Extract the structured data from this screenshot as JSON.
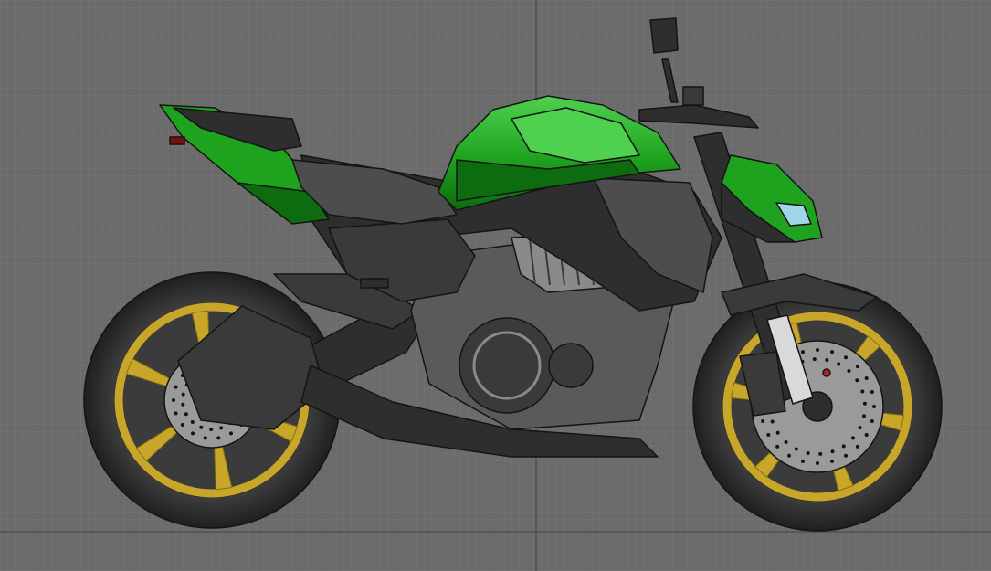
{
  "viewport": {
    "background_color": "#6b6b6b",
    "grid_minor_color": "#767676",
    "grid_major_color": "#4a4a4a"
  },
  "model": {
    "subject": "motorcycle-side-view",
    "colors": {
      "body_green": "#1fa31f",
      "body_green_light": "#4fd14f",
      "body_green_dark": "#0d6b10",
      "frame_dark": "#2e2e2e",
      "panel_dark": "#3a3a3a",
      "panel_mid": "#4d4d4d",
      "engine_gray": "#5a5a5a",
      "engine_light": "#8a8a8a",
      "tire": "#3b3b3b",
      "tire_edge": "#1f1f1f",
      "rim_gold": "#c8a62a",
      "rim_gold_dark": "#8a6f12",
      "disc": "#9a9a9a",
      "fork_chrome": "#d9d9d9",
      "outline": "#141414"
    }
  }
}
